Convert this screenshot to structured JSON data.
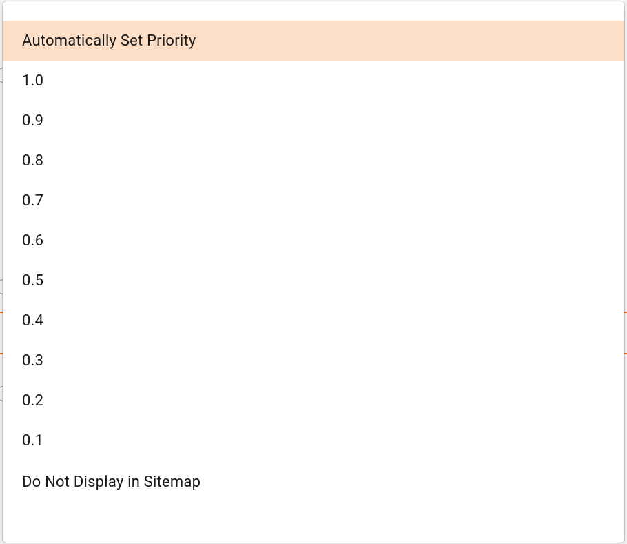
{
  "dropdown": {
    "options": [
      {
        "label": "Automatically Set Priority",
        "selected": true
      },
      {
        "label": "1.0",
        "selected": false
      },
      {
        "label": "0.9",
        "selected": false
      },
      {
        "label": "0.8",
        "selected": false
      },
      {
        "label": "0.7",
        "selected": false
      },
      {
        "label": "0.6",
        "selected": false
      },
      {
        "label": "0.5",
        "selected": false
      },
      {
        "label": "0.4",
        "selected": false
      },
      {
        "label": "0.3",
        "selected": false
      },
      {
        "label": "0.2",
        "selected": false
      },
      {
        "label": "0.1",
        "selected": false
      },
      {
        "label": "Do Not Display in Sitemap",
        "selected": false
      }
    ]
  }
}
